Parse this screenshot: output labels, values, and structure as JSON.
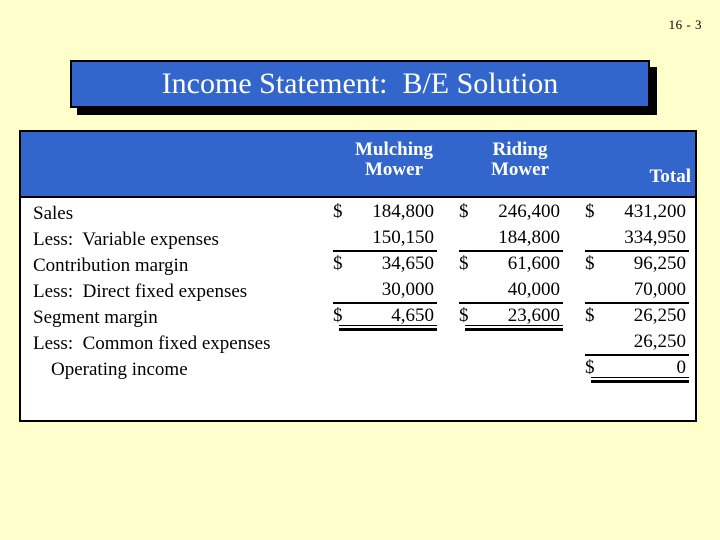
{
  "slide": {
    "number": "16 - 3",
    "title": "Income Statement:  B/E Solution",
    "background_color": "#ffffcc",
    "accent_color": "#3366cc"
  },
  "statement": {
    "column_headers": [
      {
        "line1": "Mulching",
        "line2": "Mower"
      },
      {
        "line1": "Riding",
        "line2": "Mower"
      },
      {
        "line1": "",
        "line2": "Total"
      }
    ],
    "rows": [
      {
        "label": "Sales",
        "mulching": {
          "currency": "$",
          "amount": "184,800",
          "rule": "none"
        },
        "riding": {
          "currency": "$",
          "amount": "246,400",
          "rule": "none"
        },
        "total": {
          "currency": "$",
          "amount": "431,200",
          "rule": "none"
        }
      },
      {
        "label": "Less:  Variable expenses",
        "mulching": {
          "currency": "",
          "amount": "150,150",
          "rule": "single"
        },
        "riding": {
          "currency": "",
          "amount": "184,800",
          "rule": "single"
        },
        "total": {
          "currency": "",
          "amount": "334,950",
          "rule": "single"
        }
      },
      {
        "label": "Contribution margin",
        "mulching": {
          "currency": "$",
          "amount": "34,650",
          "rule": "none"
        },
        "riding": {
          "currency": "$",
          "amount": "61,600",
          "rule": "none"
        },
        "total": {
          "currency": "$",
          "amount": "96,250",
          "rule": "none"
        }
      },
      {
        "label": "Less:  Direct fixed expenses",
        "mulching": {
          "currency": "",
          "amount": "30,000",
          "rule": "single"
        },
        "riding": {
          "currency": "",
          "amount": "40,000",
          "rule": "single"
        },
        "total": {
          "currency": "",
          "amount": "70,000",
          "rule": "single"
        }
      },
      {
        "label": "Segment margin",
        "mulching": {
          "currency": "$",
          "amount": "4,650",
          "rule": "double"
        },
        "riding": {
          "currency": "$",
          "amount": "23,600",
          "rule": "double"
        },
        "total": {
          "currency": "$",
          "amount": "26,250",
          "rule": "none"
        }
      },
      {
        "label": "Less:  Common fixed expenses",
        "mulching": {
          "currency": "",
          "amount": "",
          "rule": "none"
        },
        "riding": {
          "currency": "",
          "amount": "",
          "rule": "none"
        },
        "total": {
          "currency": "",
          "amount": "26,250",
          "rule": "single"
        }
      },
      {
        "label": "Operating income",
        "indent": true,
        "mulching": {
          "currency": "",
          "amount": "",
          "rule": "none"
        },
        "riding": {
          "currency": "",
          "amount": "",
          "rule": "none"
        },
        "total": {
          "currency": "$",
          "amount": "0",
          "rule": "double"
        }
      }
    ]
  }
}
